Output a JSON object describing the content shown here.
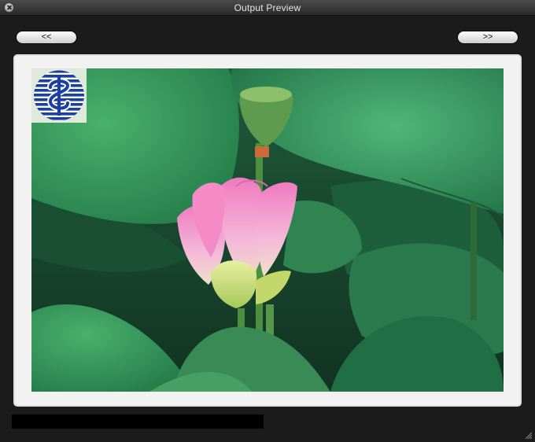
{
  "window": {
    "title": "Output Preview"
  },
  "navigation": {
    "previous_label": "<<",
    "next_label": ">>"
  },
  "preview": {
    "image_subject": "pink lotus bud with green lotus leaves",
    "logo_icon": "dollar-sign-logo-icon",
    "colors": {
      "leaf_green": "#2f8f56",
      "lotus_pink": "#f29ac8",
      "logo_blue": "#1a3fa6"
    }
  },
  "status": {
    "text": ""
  }
}
